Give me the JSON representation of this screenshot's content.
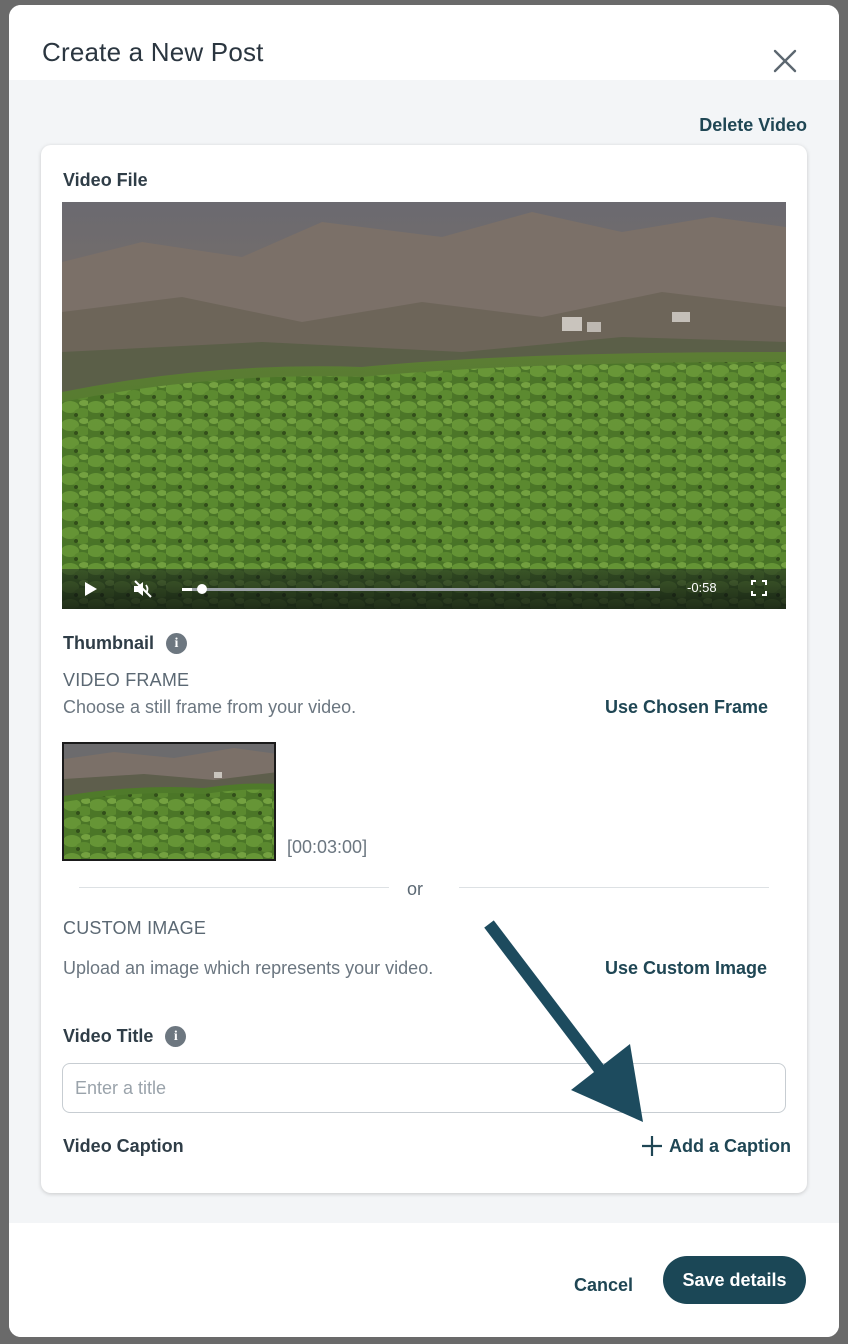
{
  "modal": {
    "title": "Create a New Post",
    "close_icon": "close-icon"
  },
  "delete_video_label": "Delete Video",
  "video_file": {
    "label": "Video File",
    "player": {
      "time_remaining": "-0:58",
      "progress": 0.02,
      "muted": true,
      "icons": [
        "play-icon",
        "muted-speaker-icon",
        "fullscreen-icon"
      ]
    }
  },
  "thumbnail": {
    "label": "Thumbnail",
    "info_icon": "info-icon",
    "video_frame": {
      "heading": "VIDEO FRAME",
      "description": "Choose a still frame from your video.",
      "action_label": "Use Chosen Frame",
      "frame_time": "[00:03:00]"
    },
    "or_label": "or",
    "custom_image": {
      "heading": "CUSTOM IMAGE",
      "description": "Upload an image which represents your video.",
      "action_label": "Use Custom Image"
    }
  },
  "video_title": {
    "label": "Video Title",
    "info_icon": "info-icon",
    "value": "",
    "placeholder": "Enter a title"
  },
  "video_caption": {
    "label": "Video Caption",
    "add_label": "Add a Caption",
    "add_icon": "plus-icon"
  },
  "footer": {
    "cancel_label": "Cancel",
    "save_label": "Save details"
  },
  "colors": {
    "accent": "#1b4756",
    "link": "#1f4654",
    "annotation_arrow": "#1d4b5e",
    "body_bg": "#f3f5f7"
  }
}
